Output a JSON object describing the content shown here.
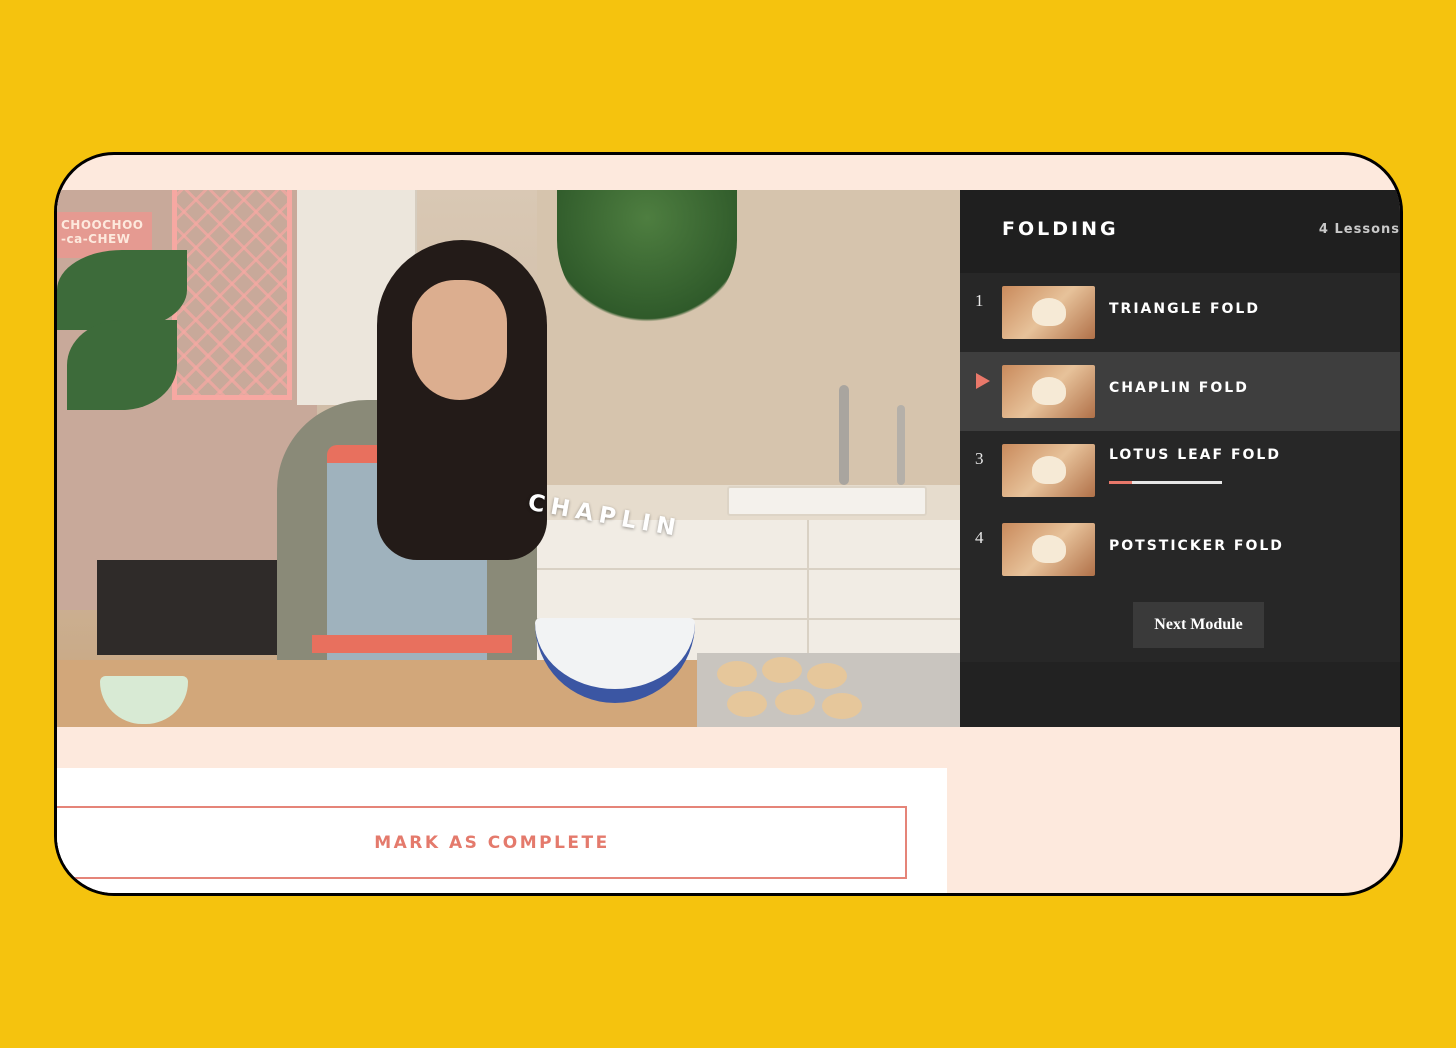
{
  "video": {
    "caption": "CHAPLIN",
    "sign_text_line1": "CHOOCHOO",
    "sign_text_line2": "-ca-CHEW"
  },
  "module": {
    "title": "FOLDING",
    "lesson_count": "4 Lessons",
    "lessons": [
      {
        "number": "1",
        "title": "TRIANGLE FOLD",
        "active": false
      },
      {
        "number": "",
        "title": "CHAPLIN FOLD",
        "active": true
      },
      {
        "number": "3",
        "title": "LOTUS LEAF FOLD",
        "active": false,
        "progress": 0.2
      },
      {
        "number": "4",
        "title": "POTSTICKER FOLD",
        "active": false
      }
    ],
    "next_label": "Next Module"
  },
  "actions": {
    "mark_complete_label": "MARK AS COMPLETE"
  },
  "colors": {
    "background": "#f5c30e",
    "accent": "#e9786a",
    "sidebar": "#272727",
    "page": "#fde9dd"
  }
}
